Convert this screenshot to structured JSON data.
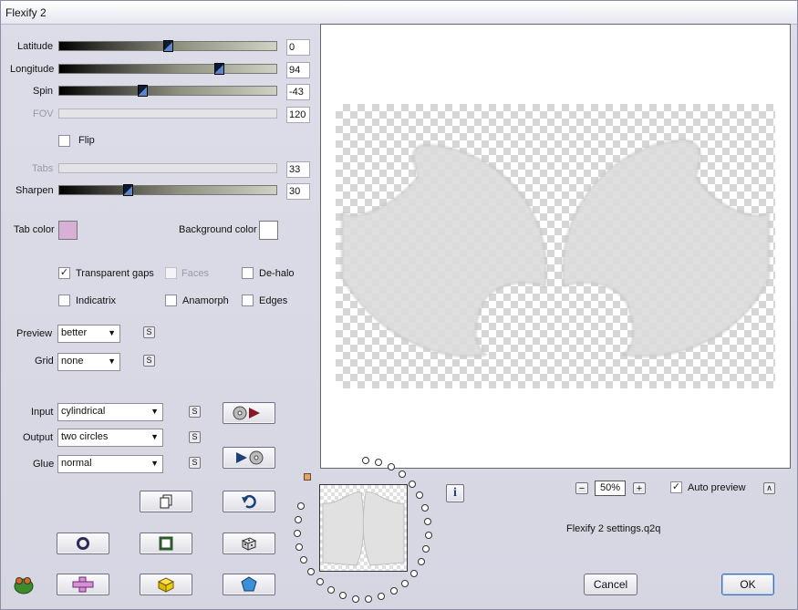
{
  "window": {
    "title": "Flexify 2"
  },
  "sliders": {
    "latitude": {
      "label": "Latitude",
      "value": "0",
      "fraction": 0.5
    },
    "longitude": {
      "label": "Longitude",
      "value": "94",
      "fraction": 0.75
    },
    "spin": {
      "label": "Spin",
      "value": "-43",
      "fraction": 0.38
    },
    "fov": {
      "label": "FOV",
      "value": "120",
      "disabled": true
    },
    "tabs": {
      "label": "Tabs",
      "value": "33",
      "disabled": true
    },
    "sharpen": {
      "label": "Sharpen",
      "value": "30",
      "fraction": 0.31
    }
  },
  "flip": {
    "label": "Flip",
    "checked": false
  },
  "colors": {
    "tab_color_label": "Tab color",
    "tab_color": "#d7afd7",
    "background_color_label": "Background color",
    "background_color": "#ffffff"
  },
  "options": {
    "transparent_gaps": {
      "label": "Transparent gaps",
      "checked": true
    },
    "faces": {
      "label": "Faces",
      "checked": false,
      "disabled": true
    },
    "de_halo": {
      "label": "De-halo",
      "checked": false
    },
    "indicatrix": {
      "label": "Indicatrix",
      "checked": false
    },
    "anamorph": {
      "label": "Anamorph",
      "checked": false
    },
    "edges": {
      "label": "Edges",
      "checked": false
    }
  },
  "preview_select": {
    "label": "Preview",
    "value": "better"
  },
  "grid_select": {
    "label": "Grid",
    "value": "none"
  },
  "input_select": {
    "label": "Input",
    "value": "cylindrical"
  },
  "output_select": {
    "label": "Output",
    "value": "two circles"
  },
  "glue_select": {
    "label": "Glue",
    "value": "normal"
  },
  "s_label": "S",
  "zoom": {
    "value": "50%",
    "minus": "−",
    "plus": "+"
  },
  "auto_preview": {
    "label": "Auto preview",
    "checked": true
  },
  "settings_file": "Flexify 2 settings.q2q",
  "info_label": "i",
  "buttons": {
    "cancel": "Cancel",
    "ok": "OK"
  }
}
